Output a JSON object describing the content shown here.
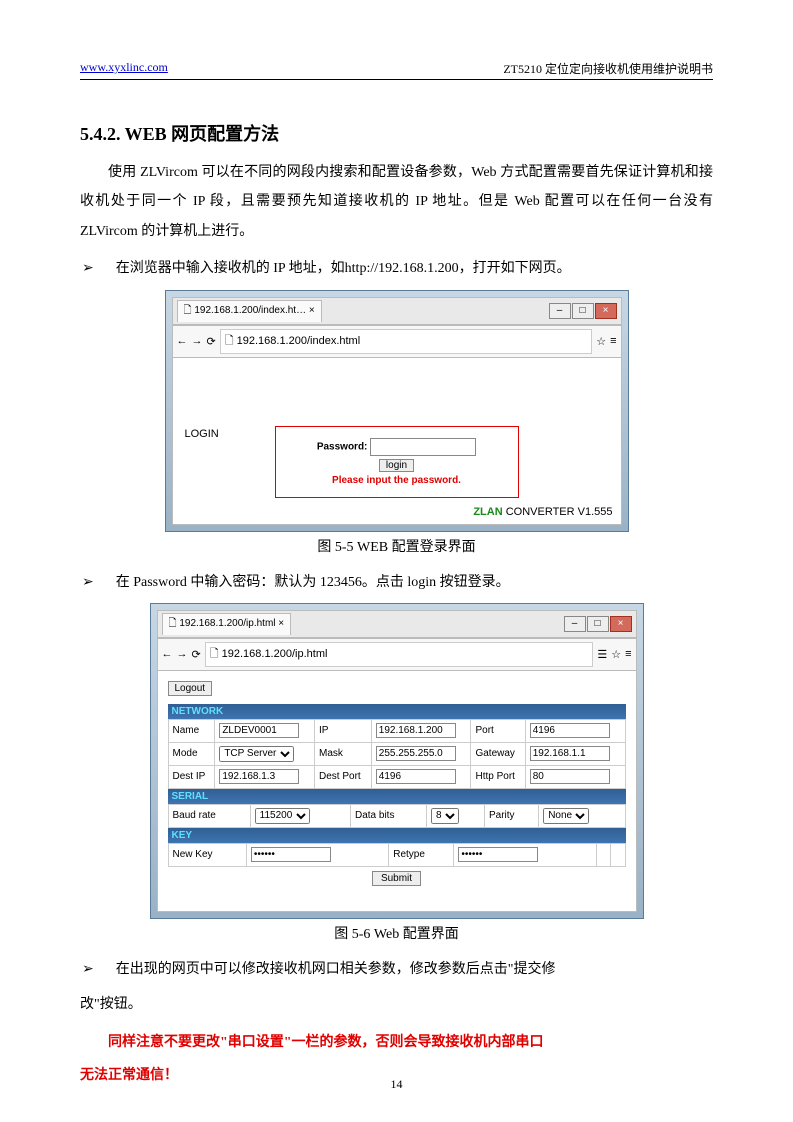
{
  "header": {
    "site_url": "www.xyxlinc.com",
    "doc_title": "ZT5210 定位定向接收机使用维护说明书"
  },
  "section_title": "5.4.2. WEB 网页配置方法",
  "para1": "使用 ZLVircom 可以在不同的网段内搜索和配置设备参数，Web 方式配置需要首先保证计算机和接收机处于同一个 IP 段，且需要预先知道接收机的 IP 地址。但是 Web 配置可以在任何一台没有 ZLVircom 的计算机上进行。",
  "bullet1": "在浏览器中输入接收机的 IP 地址，如http://192.168.1.200，打开如下网页。",
  "login_shot": {
    "tab": "192.168.1.200/index.ht…",
    "address": "192.168.1.200/index.html",
    "login_text": "LOGIN",
    "pw_label": "Password:",
    "login_btn": "login",
    "err_msg": "Please input the password.",
    "converter": "CONVERTER V1.555",
    "brand": "ZLAN"
  },
  "caption1": "图 5-5 WEB 配置登录界面",
  "bullet2": "在 Password 中输入密码：默认为 123456。点击 login 按钮登录。",
  "cfg_shot": {
    "tab": "192.168.1.200/ip.html",
    "address": "192.168.1.200/ip.html",
    "logout": "Logout",
    "sections": {
      "network": "NETWORK",
      "serial": "SERIAL",
      "key": "KEY"
    },
    "net": {
      "name_l": "Name",
      "name_v": "ZLDEV0001",
      "ip_l": "IP",
      "ip_v": "192.168.1.200",
      "port_l": "Port",
      "port_v": "4196",
      "mode_l": "Mode",
      "mode_v": "TCP Server",
      "mask_l": "Mask",
      "mask_v": "255.255.255.0",
      "gw_l": "Gateway",
      "gw_v": "192.168.1.1",
      "dip_l": "Dest IP",
      "dip_v": "192.168.1.3",
      "dp_l": "Dest Port",
      "dp_v": "4196",
      "hp_l": "Http Port",
      "hp_v": "80"
    },
    "serial": {
      "baud_l": "Baud rate",
      "baud_v": "115200",
      "db_l": "Data bits",
      "db_v": "8",
      "par_l": "Parity",
      "par_v": "None"
    },
    "key": {
      "nk_l": "New Key",
      "nk_v": "••••••",
      "rt_l": "Retype",
      "rt_v": "••••••"
    },
    "submit": "Submit"
  },
  "caption2": "图 5-6 Web 配置界面",
  "bullet3_a": "在出现的网页中可以修改接收机网口相关参数，修改参数后点击\"提交修",
  "bullet3_b": "改\"按钮。",
  "warn1": "同样注意不要更改\"串口设置\"一栏的参数，否则会导致接收机内部串口",
  "warn2": "无法正常通信！",
  "page_number": "14"
}
